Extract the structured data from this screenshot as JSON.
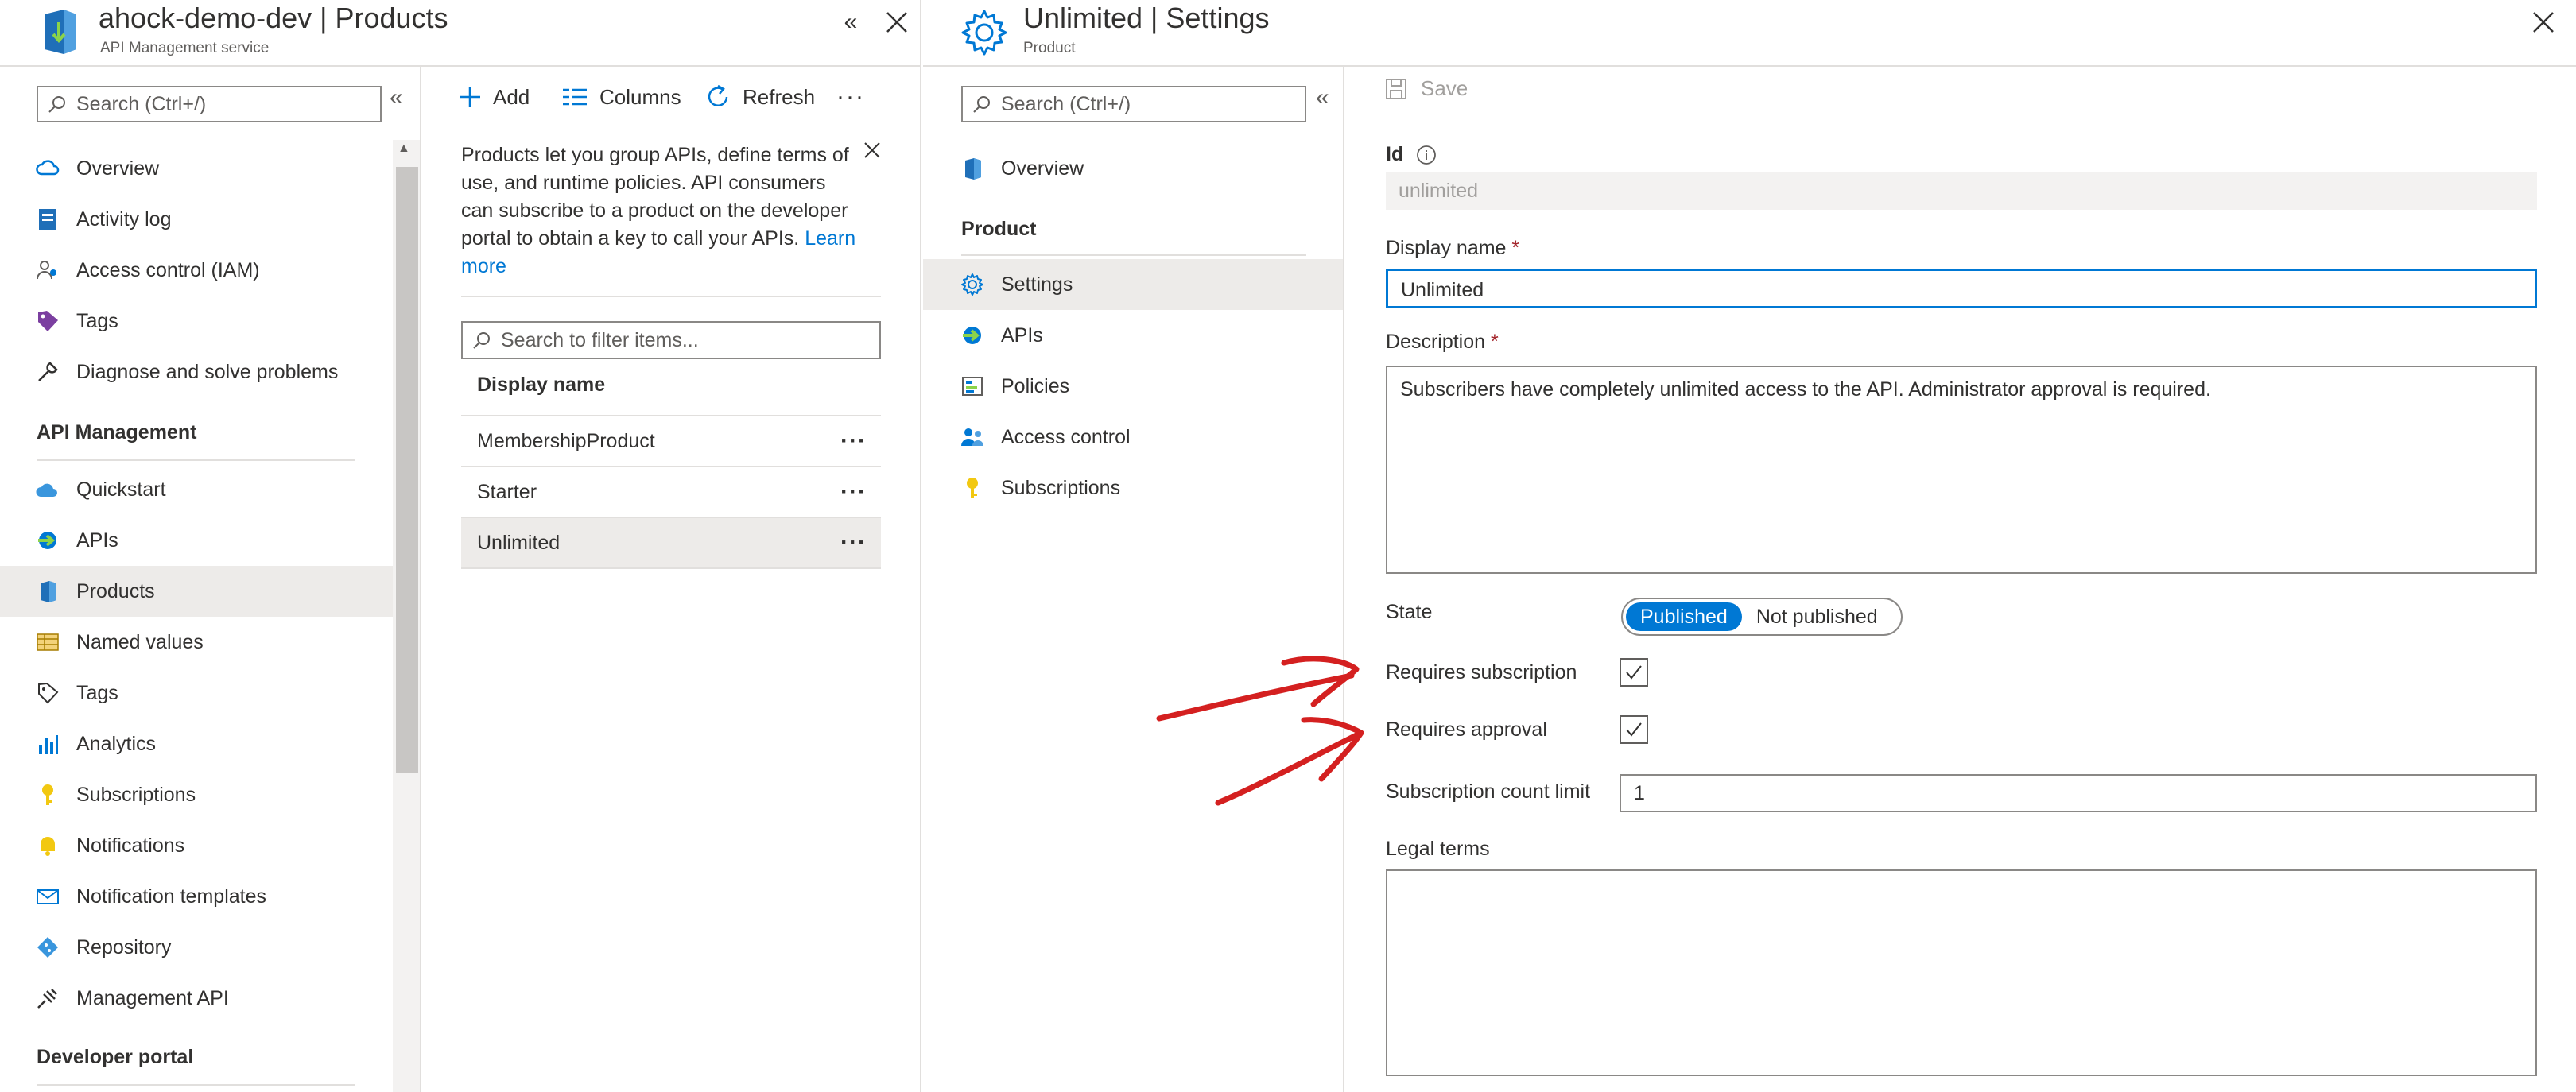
{
  "products_blade": {
    "title": "ahock-demo-dev | Products",
    "subtitle": "API Management service",
    "search_placeholder": "Search (Ctrl+/)",
    "menu_top": [
      {
        "label": "Overview",
        "icon": "cloud-icon"
      },
      {
        "label": "Activity log",
        "icon": "activity-log-icon"
      },
      {
        "label": "Access control (IAM)",
        "icon": "people-icon"
      },
      {
        "label": "Tags",
        "icon": "tag-icon"
      },
      {
        "label": "Diagnose and solve problems",
        "icon": "wrench-icon"
      }
    ],
    "section_api_management": "API Management",
    "menu_api": [
      {
        "label": "Quickstart",
        "icon": "cloud-icon"
      },
      {
        "label": "APIs",
        "icon": "api-arrow-icon"
      },
      {
        "label": "Products",
        "icon": "product-icon"
      },
      {
        "label": "Named values",
        "icon": "table-icon"
      },
      {
        "label": "Tags",
        "icon": "tag-outline-icon"
      },
      {
        "label": "Analytics",
        "icon": "bar-chart-icon"
      },
      {
        "label": "Subscriptions",
        "icon": "key-icon"
      },
      {
        "label": "Notifications",
        "icon": "bell-icon"
      },
      {
        "label": "Notification templates",
        "icon": "mail-icon"
      },
      {
        "label": "Repository",
        "icon": "git-icon"
      },
      {
        "label": "Management API",
        "icon": "plug-icon"
      }
    ],
    "section_developer_portal": "Developer portal",
    "toolbar": {
      "add": "Add",
      "columns": "Columns",
      "refresh": "Refresh"
    },
    "info_text": "Products let you group APIs, define terms of use, and runtime policies. API consumers can subscribe to a product on the developer portal to obtain a key to call your APIs.",
    "learn_more": "Learn more",
    "filter_placeholder": "Search to filter items...",
    "column_header": "Display name",
    "rows": [
      {
        "name": "MembershipProduct"
      },
      {
        "name": "Starter"
      },
      {
        "name": "Unlimited"
      }
    ]
  },
  "settings_blade": {
    "title": "Unlimited | Settings",
    "subtitle": "Product",
    "search_placeholder": "Search (Ctrl+/)",
    "overview": "Overview",
    "section_product": "Product",
    "menu": [
      {
        "label": "Settings",
        "icon": "gear-icon"
      },
      {
        "label": "APIs",
        "icon": "api-arrow-icon"
      },
      {
        "label": "Policies",
        "icon": "policies-icon"
      },
      {
        "label": "Access control",
        "icon": "people-icon"
      },
      {
        "label": "Subscriptions",
        "icon": "key-icon"
      }
    ],
    "save": "Save",
    "form": {
      "id_label": "Id",
      "id_value": "unlimited",
      "display_name_label": "Display name",
      "display_name_value": "Unlimited",
      "description_label": "Description",
      "description_value": "Subscribers have completely unlimited access to the API. Administrator approval is required.",
      "state_label": "State",
      "state_options": [
        "Published",
        "Not published"
      ],
      "state_selected": "Published",
      "requires_subscription_label": "Requires subscription",
      "requires_subscription": true,
      "requires_approval_label": "Requires approval",
      "requires_approval": true,
      "subscription_count_limit_label": "Subscription count limit",
      "subscription_count_limit_value": "1",
      "legal_terms_label": "Legal terms",
      "legal_terms_value": "",
      "required_marker": "*"
    }
  },
  "colors": {
    "accent": "#0078d4",
    "annotation": "#d42020",
    "selected_bg": "#edebe9"
  }
}
